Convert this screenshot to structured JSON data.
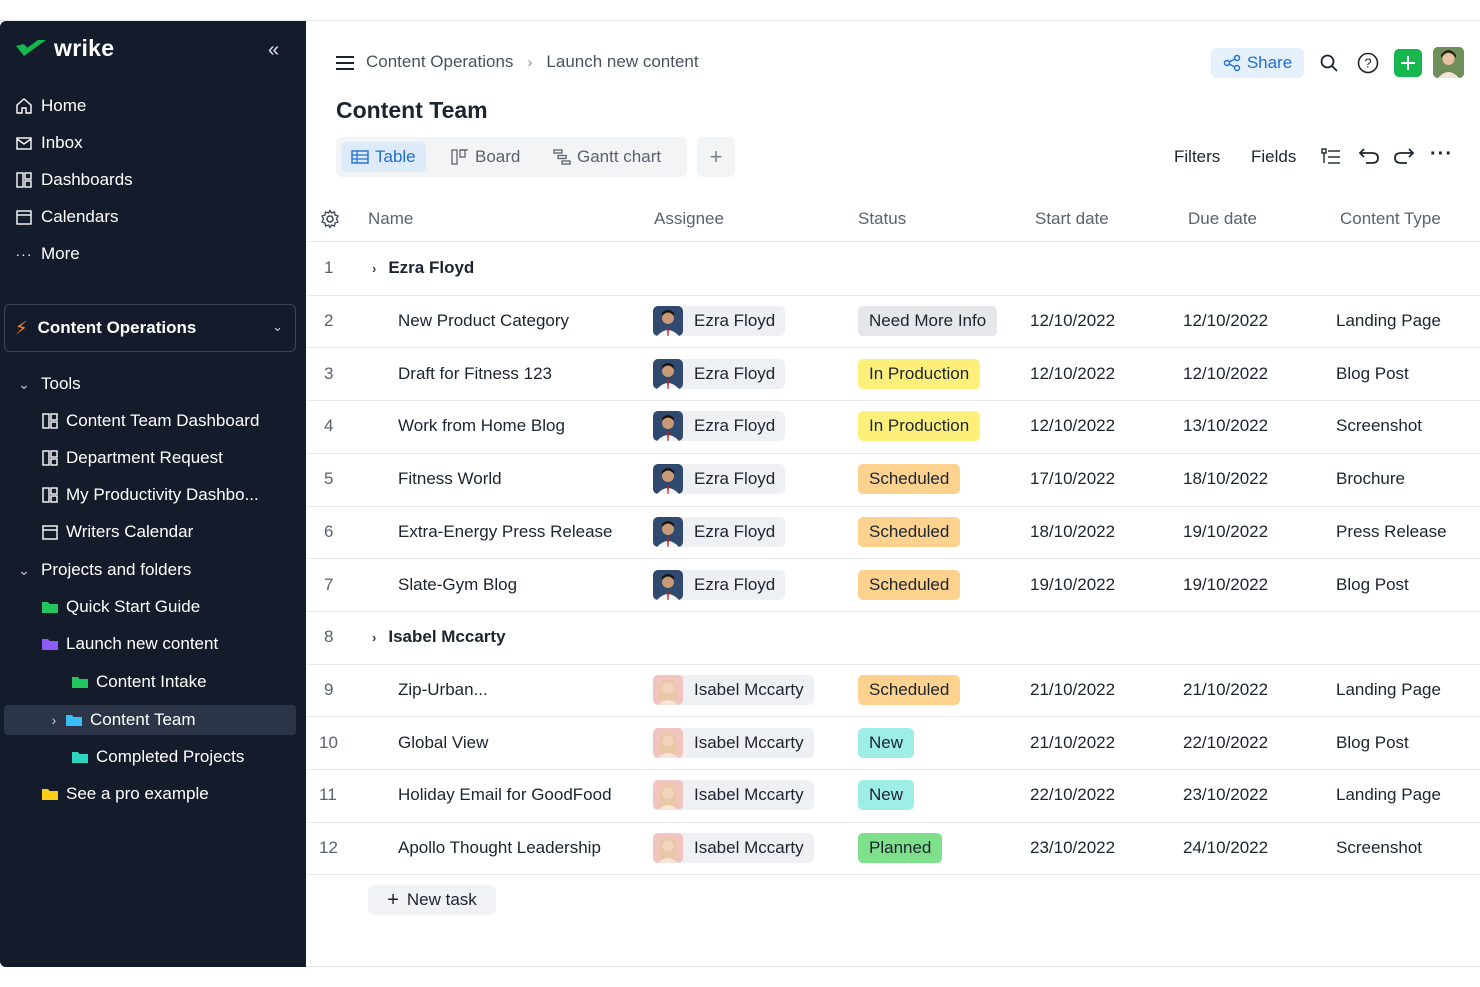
{
  "app": {
    "logo_text": "wrike"
  },
  "sidebar": {
    "nav": [
      {
        "label": "Home",
        "icon": "home-icon"
      },
      {
        "label": "Inbox",
        "icon": "inbox-icon"
      },
      {
        "label": "Dashboards",
        "icon": "dashboard-icon"
      },
      {
        "label": "Calendars",
        "icon": "calendar-icon"
      },
      {
        "label": "More",
        "icon": "more-icon"
      }
    ],
    "space": {
      "label": "Content Operations"
    },
    "tools_label": "Tools",
    "tools": [
      {
        "label": "Content Team Dashboard"
      },
      {
        "label": "Department Request"
      },
      {
        "label": "My Productivity Dashbo..."
      },
      {
        "label": "Writers Calendar"
      }
    ],
    "projects_label": "Projects and folders",
    "folders": [
      {
        "label": "Quick Start Guide",
        "color": "#22c55e"
      },
      {
        "label": "Launch new content",
        "color": "#8b5cf6"
      },
      {
        "label": "Content Intake",
        "color": "#22c55e"
      },
      {
        "label": "Content Team",
        "color": "#38bdf8"
      },
      {
        "label": "Completed Projects",
        "color": "#2dd4bf"
      },
      {
        "label": "See a pro example",
        "color": "#facc15"
      }
    ]
  },
  "header": {
    "breadcrumb": [
      "Content Operations",
      "Launch new content"
    ],
    "title": "Content Team",
    "share_label": "Share"
  },
  "views": {
    "tabs": [
      "Table",
      "Board",
      "Gantt chart"
    ],
    "active": "Table",
    "add_label": "+",
    "filters_label": "Filters",
    "fields_label": "Fields"
  },
  "table": {
    "columns": [
      "Name",
      "Assignee",
      "Status",
      "Start date",
      "Due date",
      "Content Type"
    ],
    "rows": [
      {
        "num": "1",
        "group": "Ezra Floyd"
      },
      {
        "num": "2",
        "name": "New Product Category",
        "assignee": "Ezra Floyd",
        "status": "Need More Info",
        "start": "12/10/2022",
        "due": "12/10/2022",
        "type": "Landing Page"
      },
      {
        "num": "3",
        "name": "Draft for Fitness 123",
        "assignee": "Ezra Floyd",
        "status": "In Production",
        "start": "12/10/2022",
        "due": "12/10/2022",
        "type": "Blog Post"
      },
      {
        "num": "4",
        "name": "Work from Home Blog",
        "assignee": "Ezra Floyd",
        "status": "In Production",
        "start": "12/10/2022",
        "due": "13/10/2022",
        "type": "Screenshot"
      },
      {
        "num": "5",
        "name": "Fitness World",
        "assignee": "Ezra Floyd",
        "status": "Scheduled",
        "start": "17/10/2022",
        "due": "18/10/2022",
        "type": "Brochure"
      },
      {
        "num": "6",
        "name": "Extra-Energy Press Release",
        "assignee": "Ezra Floyd",
        "status": "Scheduled",
        "start": "18/10/2022",
        "due": "19/10/2022",
        "type": "Press Release"
      },
      {
        "num": "7",
        "name": "Slate-Gym Blog",
        "assignee": "Ezra Floyd",
        "status": "Scheduled",
        "start": "19/10/2022",
        "due": "19/10/2022",
        "type": "Blog Post"
      },
      {
        "num": "8",
        "group": "Isabel Mccarty"
      },
      {
        "num": "9",
        "name": "Zip-Urban...",
        "assignee": "Isabel Mccarty",
        "status": "Scheduled",
        "start": "21/10/2022",
        "due": "21/10/2022",
        "type": "Landing Page"
      },
      {
        "num": "10",
        "name": "Global View",
        "assignee": "Isabel Mccarty",
        "status": "New",
        "start": "21/10/2022",
        "due": "22/10/2022",
        "type": "Blog Post"
      },
      {
        "num": "11",
        "name": "Holiday Email for GoodFood",
        "assignee": "Isabel Mccarty",
        "status": "New",
        "start": "22/10/2022",
        "due": "23/10/2022",
        "type": "Landing Page"
      },
      {
        "num": "12",
        "name": "Apollo Thought Leadership",
        "assignee": "Isabel Mccarty",
        "status": "Planned",
        "start": "23/10/2022",
        "due": "24/10/2022",
        "type": "Screenshot"
      }
    ],
    "new_task_label": "New task"
  },
  "status_colors": {
    "Need More Info": "#e5e7eb",
    "In Production": "#fdf07a",
    "Scheduled": "#fdd28f",
    "New": "#9eeee6",
    "Planned": "#7ee08a"
  },
  "colors": {
    "sidebar_bg": "#141c2b",
    "accent": "#1f6fd1",
    "add_button": "#16b84e"
  }
}
